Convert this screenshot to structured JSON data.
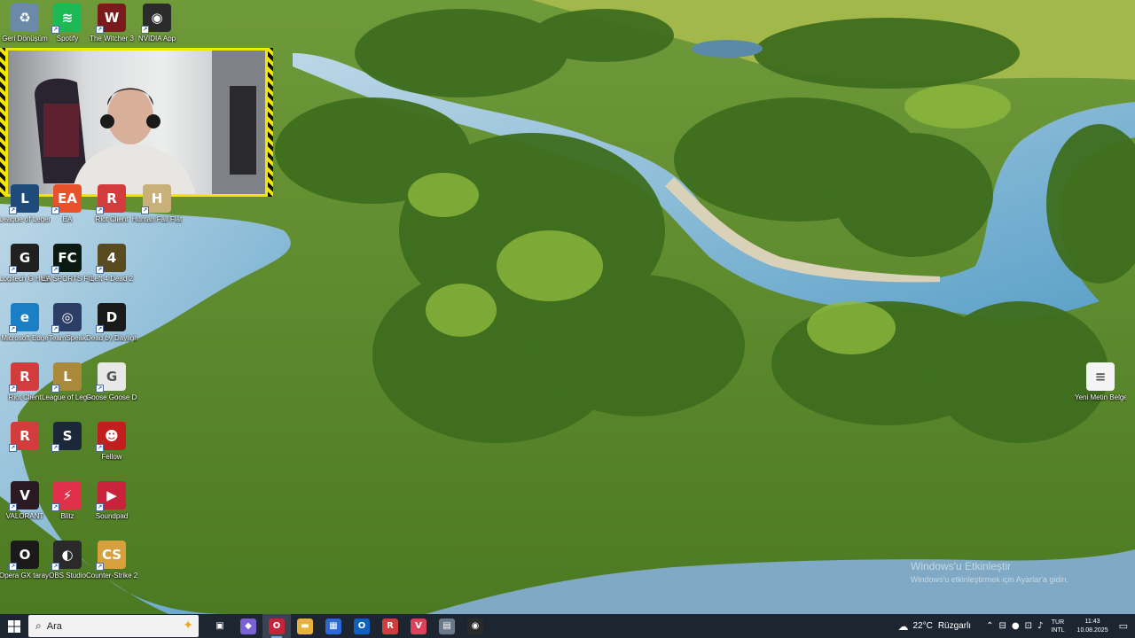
{
  "desktop_icons": [
    {
      "id": "recycle-bin",
      "label": "Geri Dönüşüm",
      "bg": "#6a8aa8",
      "glyph": "♻"
    },
    {
      "id": "spotify",
      "label": "Spotify",
      "bg": "#1db954",
      "glyph": "≋"
    },
    {
      "id": "witcher3",
      "label": "The Witcher 3",
      "bg": "#7a1a1a",
      "glyph": "W"
    },
    {
      "id": "nvidia-app",
      "label": "NVIDIA App",
      "bg": "#2b2b2b",
      "glyph": "◉"
    },
    {
      "id": "league-of-legends-1",
      "label": "League of Legends",
      "bg": "#1e4b7a",
      "glyph": "L"
    },
    {
      "id": "ea",
      "label": "EA",
      "bg": "#e7522b",
      "glyph": "EA"
    },
    {
      "id": "riot-client-1",
      "label": "Riot Client",
      "bg": "#d23c3c",
      "glyph": "R"
    },
    {
      "id": "human-fall-flat",
      "label": "Human Fall Flat",
      "bg": "#c9b07a",
      "glyph": "H"
    },
    {
      "id": "logitech-ghub",
      "label": "Logitech G HUB",
      "bg": "#202020",
      "glyph": "G"
    },
    {
      "id": "ea-fc25",
      "label": "EA SPORTS FC 25",
      "bg": "#0a1a10",
      "glyph": "FC"
    },
    {
      "id": "left4dead2",
      "label": "Left 4 Dead 2",
      "bg": "#5a4a20",
      "glyph": "4"
    },
    {
      "id": "edge",
      "label": "Microsoft Edge",
      "bg": "#1a7fc4",
      "glyph": "e"
    },
    {
      "id": "teamspeak",
      "label": "TeamSpeak",
      "bg": "#2c3e66",
      "glyph": "◎"
    },
    {
      "id": "dead-by-daylight",
      "label": "Dead by Daylight",
      "bg": "#1a1a1a",
      "glyph": "D"
    },
    {
      "id": "riot-client-2",
      "label": "Riot Client",
      "bg": "#d23c3c",
      "glyph": "R"
    },
    {
      "id": "league-of-legends-2",
      "label": "League of Legends",
      "bg": "#a88a3a",
      "glyph": "L"
    },
    {
      "id": "goose-goose-duck",
      "label": "Goose Goose Duck",
      "bg": "#e8e8e8",
      "glyph": "G"
    },
    {
      "id": "riot-client-3",
      "label": "",
      "bg": "#d23c3c",
      "glyph": "R"
    },
    {
      "id": "steam",
      "label": "",
      "bg": "#1b2838",
      "glyph": "S"
    },
    {
      "id": "fallguys-like",
      "label": "Fellow",
      "bg": "#c21e1e",
      "glyph": "☻"
    },
    {
      "id": "valorant",
      "label": "VALORANT",
      "bg": "#2b1a22",
      "glyph": "V"
    },
    {
      "id": "blitz",
      "label": "Blitz",
      "bg": "#e0304a",
      "glyph": "⚡"
    },
    {
      "id": "soundpad",
      "label": "Soundpad",
      "bg": "#c8233a",
      "glyph": "▶"
    },
    {
      "id": "opera-gx",
      "label": "Opera GX tarayıcı",
      "bg": "#1a1a1a",
      "glyph": "O"
    },
    {
      "id": "obs-studio",
      "label": "OBS Studio",
      "bg": "#2a2a2a",
      "glyph": "◐"
    },
    {
      "id": "counter-strike2",
      "label": "Counter-Strike 2",
      "bg": "#d8a03a",
      "glyph": "CS"
    },
    {
      "id": "yeni-metin-belgesi",
      "label": "Yeni Metin Belgesi",
      "bg": "#f4f4f4",
      "glyph": "≡"
    }
  ],
  "watermark": {
    "title": "Windows'u Etkinleştir",
    "subtitle": "Windows'u etkinleştirmek için Ayarlar'a gidin."
  },
  "taskbar": {
    "search_placeholder": "Ara",
    "apps": [
      {
        "id": "task-view",
        "glyph": "▣",
        "bg": "transparent",
        "active": false
      },
      {
        "id": "copilot",
        "glyph": "◆",
        "bg": "#7b61d6",
        "active": false
      },
      {
        "id": "opera",
        "glyph": "O",
        "bg": "#c8233a",
        "active": true
      },
      {
        "id": "file-explorer",
        "glyph": "▬",
        "bg": "#e8b33a",
        "active": false
      },
      {
        "id": "microsoft-store",
        "glyph": "▦",
        "bg": "#2a6ad4",
        "active": false
      },
      {
        "id": "outlook",
        "glyph": "O",
        "bg": "#1060c0",
        "active": false
      },
      {
        "id": "riot",
        "glyph": "R",
        "bg": "#d23c3c",
        "active": false
      },
      {
        "id": "valorant",
        "glyph": "V",
        "bg": "#e0405a",
        "active": false
      },
      {
        "id": "app-gray",
        "glyph": "▤",
        "bg": "#6a7a8a",
        "active": false
      },
      {
        "id": "obs",
        "glyph": "◉",
        "bg": "#2a2a2a",
        "active": false
      }
    ],
    "weather": {
      "temp": "22°C",
      "condition": "Rüzgarlı"
    },
    "lang_top": "TUR",
    "lang_bottom": "INTL",
    "time": "11:43",
    "date": "10.08.2025"
  }
}
